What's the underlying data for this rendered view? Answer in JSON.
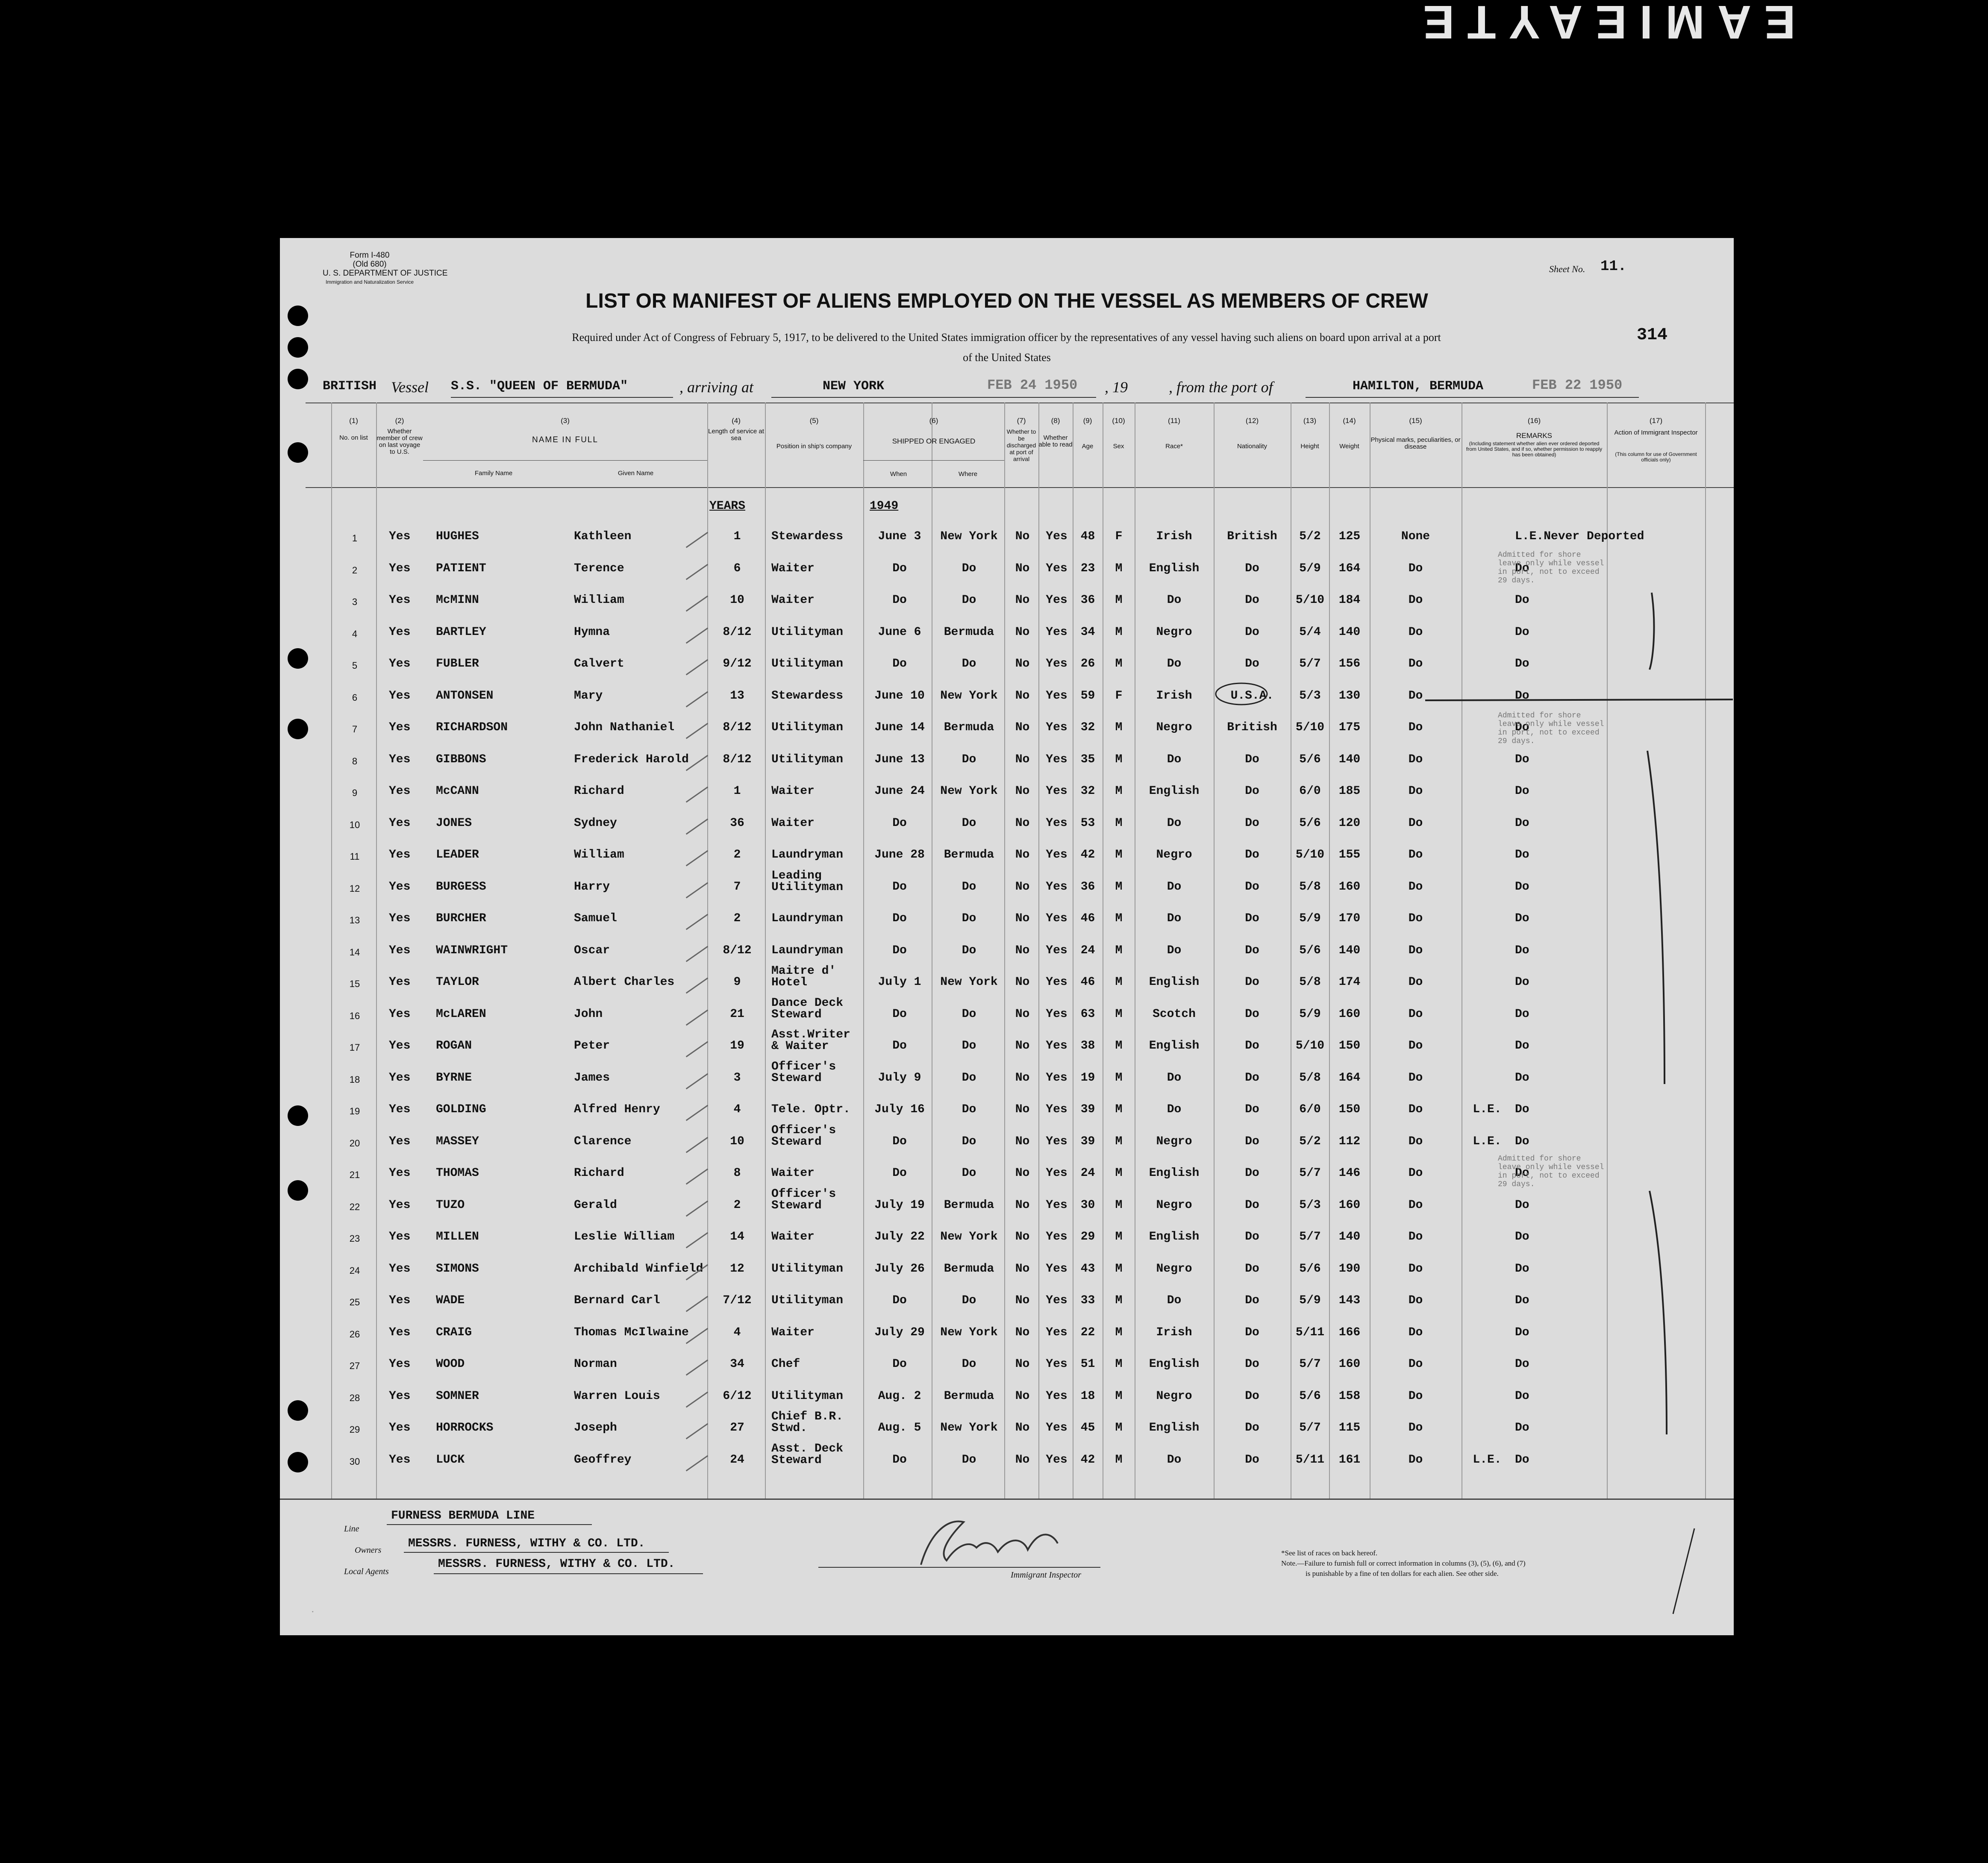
{
  "corner_text": "ƎTYAƎIMAƎ",
  "form": {
    "form_number": "Form I-480",
    "old_number": "(Old 680)",
    "department": "U. S. DEPARTMENT OF JUSTICE",
    "service": "Immigration and Naturalization Service",
    "sheet_label": "Sheet No.",
    "sheet_no": "11.",
    "page_no": "314",
    "title": "LIST OR MANIFEST OF ALIENS EMPLOYED ON THE VESSEL AS MEMBERS OF CREW",
    "subtitle": "Required under Act of Congress of February 5, 1917, to be delivered to the United States immigration officer by the representatives of any vessel having such aliens on board upon arrival at a port",
    "subtitle2": "of the United States"
  },
  "voyage": {
    "nationality": "BRITISH",
    "vessel_label": "Vessel",
    "vessel": "S.S. \"QUEEN OF BERMUDA\"",
    "arriving_label": ", arriving at",
    "arrival_port": "NEW YORK",
    "arrival_date": "FEB 24 1950",
    "year_label": ", 19",
    "from_label": ", from the port of",
    "departure_port": "HAMILTON, BERMUDA",
    "departure_date": "FEB 22 1950"
  },
  "columns": {
    "c1_num": "(1)",
    "c1": "No. on list",
    "c2_num": "(2)",
    "c2": "Whether member of crew on last voyage to U.S.",
    "c3_num": "(3)",
    "c3": "NAME IN FULL",
    "c3a": "Family Name",
    "c3b": "Given Name",
    "c4_num": "(4)",
    "c4": "Length of service at sea",
    "c5_num": "(5)",
    "c5": "Position in ship's company",
    "c6_num": "(6)",
    "c6": "SHIPPED OR ENGAGED",
    "c6a": "When",
    "c6b": "Where",
    "c7_num": "(7)",
    "c7": "Whether to be discharged at port of arrival",
    "c8_num": "(8)",
    "c8": "Whether able to read",
    "c9_num": "(9)",
    "c9": "Age",
    "c10_num": "(10)",
    "c10": "Sex",
    "c11_num": "(11)",
    "c11": "Race*",
    "c12_num": "(12)",
    "c12": "Nationality",
    "c13_num": "(13)",
    "c13": "Height",
    "c14_num": "(14)",
    "c14": "Weight",
    "c15_num": "(15)",
    "c15": "Physical marks, peculiarities, or disease",
    "c16_num": "(16)",
    "c16": "REMARKS",
    "c16b": "(Including statement whether alien ever ordered deported from United States, and if so, whether permission to reapply has been obtained)",
    "c17_num": "(17)",
    "c17": "Action of Immigrant Inspector",
    "c17b": "(This column for use of Government officials only)"
  },
  "years_header": "YEARS",
  "year_header": "1949",
  "rows": [
    {
      "no": "1",
      "crew": "Yes",
      "family": "HUGHES",
      "given": "Kathleen",
      "service": "1",
      "position": "Stewardess",
      "when": "June 3",
      "where": "New York",
      "discharge": "No",
      "read": "Yes",
      "age": "48",
      "sex": "F",
      "race": "Irish",
      "nationality": "British",
      "height": "5/2",
      "weight": "125",
      "marks": "None",
      "l_e": "",
      "remarks": "L.E.Never Deported"
    },
    {
      "no": "2",
      "crew": "Yes",
      "family": "PATIENT",
      "given": "Terence",
      "service": "6",
      "position": "Waiter",
      "when": "Do",
      "where": "Do",
      "discharge": "No",
      "read": "Yes",
      "age": "23",
      "sex": "M",
      "race": "English",
      "nationality": "Do",
      "height": "5/9",
      "weight": "164",
      "marks": "Do",
      "l_e": "",
      "remarks": "Do"
    },
    {
      "no": "3",
      "crew": "Yes",
      "family": "McMINN",
      "given": "William",
      "service": "10",
      "position": "Waiter",
      "when": "Do",
      "where": "Do",
      "discharge": "No",
      "read": "Yes",
      "age": "36",
      "sex": "M",
      "race": "Do",
      "nationality": "Do",
      "height": "5/10",
      "weight": "184",
      "marks": "Do",
      "l_e": "",
      "remarks": "Do"
    },
    {
      "no": "4",
      "crew": "Yes",
      "family": "BARTLEY",
      "given": "Hymna",
      "service": "8/12",
      "position": "Utilityman",
      "when": "June 6",
      "where": "Bermuda",
      "discharge": "No",
      "read": "Yes",
      "age": "34",
      "sex": "M",
      "race": "Negro",
      "nationality": "Do",
      "height": "5/4",
      "weight": "140",
      "marks": "Do",
      "l_e": "",
      "remarks": "Do"
    },
    {
      "no": "5",
      "crew": "Yes",
      "family": "FUBLER",
      "given": "Calvert",
      "service": "9/12",
      "position": "Utilityman",
      "when": "Do",
      "where": "Do",
      "discharge": "No",
      "read": "Yes",
      "age": "26",
      "sex": "M",
      "race": "Do",
      "nationality": "Do",
      "height": "5/7",
      "weight": "156",
      "marks": "Do",
      "l_e": "",
      "remarks": "Do"
    },
    {
      "no": "6",
      "crew": "Yes",
      "family": "ANTONSEN",
      "given": "Mary",
      "service": "13",
      "position": "Stewardess",
      "when": "June 10",
      "where": "New York",
      "discharge": "No",
      "read": "Yes",
      "age": "59",
      "sex": "F",
      "race": "Irish",
      "nationality": "U.S.A.",
      "height": "5/3",
      "weight": "130",
      "marks": "Do",
      "l_e": "",
      "remarks": "Do"
    },
    {
      "no": "7",
      "crew": "Yes",
      "family": "RICHARDSON",
      "given": "John Nathaniel",
      "service": "8/12",
      "position": "Utilityman",
      "when": "June 14",
      "where": "Bermuda",
      "discharge": "No",
      "read": "Yes",
      "age": "32",
      "sex": "M",
      "race": "Negro",
      "nationality": "British",
      "height": "5/10",
      "weight": "175",
      "marks": "Do",
      "l_e": "",
      "remarks": "Do"
    },
    {
      "no": "8",
      "crew": "Yes",
      "family": "GIBBONS",
      "given": "Frederick Harold",
      "service": "8/12",
      "position": "Utilityman",
      "when": "June 13",
      "where": "Do",
      "discharge": "No",
      "read": "Yes",
      "age": "35",
      "sex": "M",
      "race": "Do",
      "nationality": "Do",
      "height": "5/6",
      "weight": "140",
      "marks": "Do",
      "l_e": "",
      "remarks": "Do"
    },
    {
      "no": "9",
      "crew": "Yes",
      "family": "McCANN",
      "given": "Richard",
      "service": "1",
      "position": "Waiter",
      "when": "June 24",
      "where": "New York",
      "discharge": "No",
      "read": "Yes",
      "age": "32",
      "sex": "M",
      "race": "English",
      "nationality": "Do",
      "height": "6/0",
      "weight": "185",
      "marks": "Do",
      "l_e": "",
      "remarks": "Do"
    },
    {
      "no": "10",
      "crew": "Yes",
      "family": "JONES",
      "given": "Sydney",
      "service": "36",
      "position": "Waiter",
      "when": "Do",
      "where": "Do",
      "discharge": "No",
      "read": "Yes",
      "age": "53",
      "sex": "M",
      "race": "Do",
      "nationality": "Do",
      "height": "5/6",
      "weight": "120",
      "marks": "Do",
      "l_e": "",
      "remarks": "Do"
    },
    {
      "no": "11",
      "crew": "Yes",
      "family": "LEADER",
      "given": "William",
      "service": "2",
      "position": "Laundryman",
      "when": "June 28",
      "where": "Bermuda",
      "discharge": "No",
      "read": "Yes",
      "age": "42",
      "sex": "M",
      "race": "Negro",
      "nationality": "Do",
      "height": "5/10",
      "weight": "155",
      "marks": "Do",
      "l_e": "",
      "remarks": "Do"
    },
    {
      "no": "12",
      "crew": "Yes",
      "family": "BURGESS",
      "given": "Harry",
      "service": "7",
      "position": "Leading Utilityman",
      "when": "Do",
      "where": "Do",
      "discharge": "No",
      "read": "Yes",
      "age": "36",
      "sex": "M",
      "race": "Do",
      "nationality": "Do",
      "height": "5/8",
      "weight": "160",
      "marks": "Do",
      "l_e": "",
      "remarks": "Do"
    },
    {
      "no": "13",
      "crew": "Yes",
      "family": "BURCHER",
      "given": "Samuel",
      "service": "2",
      "position": "Laundryman",
      "when": "Do",
      "where": "Do",
      "discharge": "No",
      "read": "Yes",
      "age": "46",
      "sex": "M",
      "race": "Do",
      "nationality": "Do",
      "height": "5/9",
      "weight": "170",
      "marks": "Do",
      "l_e": "",
      "remarks": "Do"
    },
    {
      "no": "14",
      "crew": "Yes",
      "family": "WAINWRIGHT",
      "given": "Oscar",
      "service": "8/12",
      "position": "Laundryman",
      "when": "Do",
      "where": "Do",
      "discharge": "No",
      "read": "Yes",
      "age": "24",
      "sex": "M",
      "race": "Do",
      "nationality": "Do",
      "height": "5/6",
      "weight": "140",
      "marks": "Do",
      "l_e": "",
      "remarks": "Do"
    },
    {
      "no": "15",
      "crew": "Yes",
      "family": "TAYLOR",
      "given": "Albert Charles",
      "service": "9",
      "position": "Maitre d' Hotel",
      "when": "July 1",
      "where": "New York",
      "discharge": "No",
      "read": "Yes",
      "age": "46",
      "sex": "M",
      "race": "English",
      "nationality": "Do",
      "height": "5/8",
      "weight": "174",
      "marks": "Do",
      "l_e": "",
      "remarks": "Do"
    },
    {
      "no": "16",
      "crew": "Yes",
      "family": "McLAREN",
      "given": "John",
      "service": "21",
      "position": "Dance Deck Steward",
      "when": "Do",
      "where": "Do",
      "discharge": "No",
      "read": "Yes",
      "age": "63",
      "sex": "M",
      "race": "Scotch",
      "nationality": "Do",
      "height": "5/9",
      "weight": "160",
      "marks": "Do",
      "l_e": "",
      "remarks": "Do"
    },
    {
      "no": "17",
      "crew": "Yes",
      "family": "ROGAN",
      "given": "Peter",
      "service": "19",
      "position": "Asst.Writer & Waiter",
      "when": "Do",
      "where": "Do",
      "discharge": "No",
      "read": "Yes",
      "age": "38",
      "sex": "M",
      "race": "English",
      "nationality": "Do",
      "height": "5/10",
      "weight": "150",
      "marks": "Do",
      "l_e": "",
      "remarks": "Do"
    },
    {
      "no": "18",
      "crew": "Yes",
      "family": "BYRNE",
      "given": "James",
      "service": "3",
      "position": "Officer's Steward",
      "when": "July 9",
      "where": "Do",
      "discharge": "No",
      "read": "Yes",
      "age": "19",
      "sex": "M",
      "race": "Do",
      "nationality": "Do",
      "height": "5/8",
      "weight": "164",
      "marks": "Do",
      "l_e": "",
      "remarks": "Do"
    },
    {
      "no": "19",
      "crew": "Yes",
      "family": "GOLDING",
      "given": "Alfred Henry",
      "service": "4",
      "position": "Tele. Optr.",
      "when": "July 16",
      "where": "Do",
      "discharge": "No",
      "read": "Yes",
      "age": "39",
      "sex": "M",
      "race": "Do",
      "nationality": "Do",
      "height": "6/0",
      "weight": "150",
      "marks": "Do",
      "l_e": "L.E.",
      "remarks": "Do"
    },
    {
      "no": "20",
      "crew": "Yes",
      "family": "MASSEY",
      "given": "Clarence",
      "service": "10",
      "position": "Officer's Steward",
      "when": "Do",
      "where": "Do",
      "discharge": "No",
      "read": "Yes",
      "age": "39",
      "sex": "M",
      "race": "Negro",
      "nationality": "Do",
      "height": "5/2",
      "weight": "112",
      "marks": "Do",
      "l_e": "L.E.",
      "remarks": "Do"
    },
    {
      "no": "21",
      "crew": "Yes",
      "family": "THOMAS",
      "given": "Richard",
      "service": "8",
      "position": "Waiter",
      "when": "Do",
      "where": "Do",
      "discharge": "No",
      "read": "Yes",
      "age": "24",
      "sex": "M",
      "race": "English",
      "nationality": "Do",
      "height": "5/7",
      "weight": "146",
      "marks": "Do",
      "l_e": "",
      "remarks": "Do"
    },
    {
      "no": "22",
      "crew": "Yes",
      "family": "TUZO",
      "given": "Gerald",
      "service": "2",
      "position": "Officer's Steward",
      "when": "July 19",
      "where": "Bermuda",
      "discharge": "No",
      "read": "Yes",
      "age": "30",
      "sex": "M",
      "race": "Negro",
      "nationality": "Do",
      "height": "5/3",
      "weight": "160",
      "marks": "Do",
      "l_e": "",
      "remarks": "Do"
    },
    {
      "no": "23",
      "crew": "Yes",
      "family": "MILLEN",
      "given": "Leslie William",
      "service": "14",
      "position": "Waiter",
      "when": "July 22",
      "where": "New York",
      "discharge": "No",
      "read": "Yes",
      "age": "29",
      "sex": "M",
      "race": "English",
      "nationality": "Do",
      "height": "5/7",
      "weight": "140",
      "marks": "Do",
      "l_e": "",
      "remarks": "Do"
    },
    {
      "no": "24",
      "crew": "Yes",
      "family": "SIMONS",
      "given": "Archibald Winfield",
      "service": "12",
      "position": "Utilityman",
      "when": "July 26",
      "where": "Bermuda",
      "discharge": "No",
      "read": "Yes",
      "age": "43",
      "sex": "M",
      "race": "Negro",
      "nationality": "Do",
      "height": "5/6",
      "weight": "190",
      "marks": "Do",
      "l_e": "",
      "remarks": "Do"
    },
    {
      "no": "25",
      "crew": "Yes",
      "family": "WADE",
      "given": "Bernard Carl",
      "service": "7/12",
      "position": "Utilityman",
      "when": "Do",
      "where": "Do",
      "discharge": "No",
      "read": "Yes",
      "age": "33",
      "sex": "M",
      "race": "Do",
      "nationality": "Do",
      "height": "5/9",
      "weight": "143",
      "marks": "Do",
      "l_e": "",
      "remarks": "Do"
    },
    {
      "no": "26",
      "crew": "Yes",
      "family": "CRAIG",
      "given": "Thomas McIlwaine",
      "service": "4",
      "position": "Waiter",
      "when": "July 29",
      "where": "New York",
      "discharge": "No",
      "read": "Yes",
      "age": "22",
      "sex": "M",
      "race": "Irish",
      "nationality": "Do",
      "height": "5/11",
      "weight": "166",
      "marks": "Do",
      "l_e": "",
      "remarks": "Do"
    },
    {
      "no": "27",
      "crew": "Yes",
      "family": "WOOD",
      "given": "Norman",
      "service": "34",
      "position": "Chef",
      "when": "Do",
      "where": "Do",
      "discharge": "No",
      "read": "Yes",
      "age": "51",
      "sex": "M",
      "race": "English",
      "nationality": "Do",
      "height": "5/7",
      "weight": "160",
      "marks": "Do",
      "l_e": "",
      "remarks": "Do"
    },
    {
      "no": "28",
      "crew": "Yes",
      "family": "SOMNER",
      "given": "Warren Louis",
      "service": "6/12",
      "position": "Utilityman",
      "when": "Aug. 2",
      "where": "Bermuda",
      "discharge": "No",
      "read": "Yes",
      "age": "18",
      "sex": "M",
      "race": "Negro",
      "nationality": "Do",
      "height": "5/6",
      "weight": "158",
      "marks": "Do",
      "l_e": "",
      "remarks": "Do"
    },
    {
      "no": "29",
      "crew": "Yes",
      "family": "HORROCKS",
      "given": "Joseph",
      "service": "27",
      "position": "Chief B.R. Stwd.",
      "when": "Aug. 5",
      "where": "New York",
      "discharge": "No",
      "read": "Yes",
      "age": "45",
      "sex": "M",
      "race": "English",
      "nationality": "Do",
      "height": "5/7",
      "weight": "115",
      "marks": "Do",
      "l_e": "",
      "remarks": "Do"
    },
    {
      "no": "30",
      "crew": "Yes",
      "family": "LUCK",
      "given": "Geoffrey",
      "service": "24",
      "position": "Asst. Deck Steward",
      "when": "Do",
      "where": "Do",
      "discharge": "No",
      "read": "Yes",
      "age": "42",
      "sex": "M",
      "race": "Do",
      "nationality": "Do",
      "height": "5/11",
      "weight": "161",
      "marks": "Do",
      "l_e": "L.E.",
      "remarks": "Do"
    }
  ],
  "stamps": {
    "stamp1": "Admitted for shore leave only while vessel in port, not to exceed 29 days.",
    "stamp2": "Admitted for shore leave only while vessel in port, not to exceed 29 days.",
    "stamp3": "Admitted for shore leave only while vessel in port, not to exceed 29 days."
  },
  "footer": {
    "line_label": "Line",
    "line": "FURNESS BERMUDA LINE",
    "owners_label": "Owners",
    "owners": "MESSRS. FURNESS, WITHY & CO. LTD.",
    "agents_label": "Local Agents",
    "agents": "MESSRS. FURNESS, WITHY & CO. LTD.",
    "inspector_label": "Immigrant Inspector",
    "note1": "*See list of races on back hereof.",
    "note2": "Note.—Failure to furnish full or correct information in columns (3), (5), (6), and (7)",
    "note3": "is punishable by a fine of ten dollars for each alien. See other side."
  }
}
